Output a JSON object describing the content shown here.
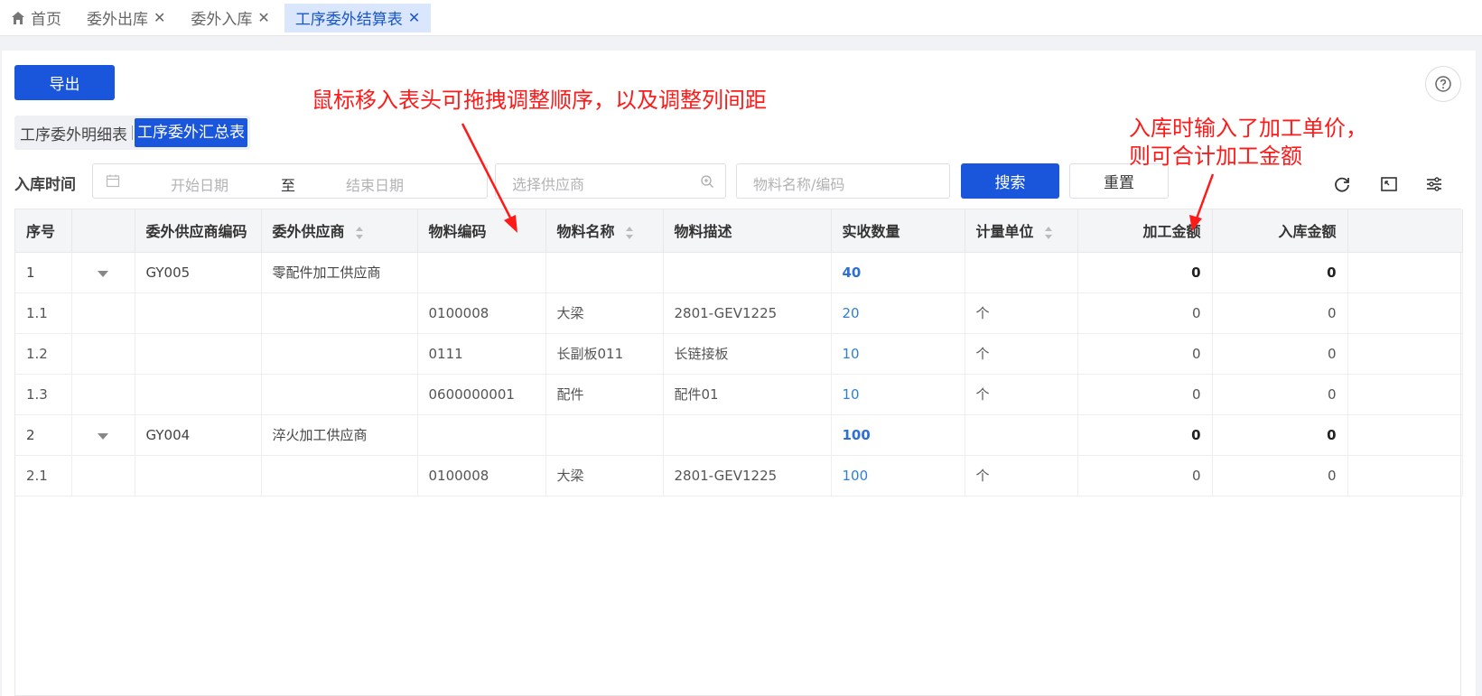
{
  "tabs": [
    {
      "label": "首页",
      "active": false,
      "closable": false,
      "icon": "home-icon"
    },
    {
      "label": "委外出库",
      "active": false,
      "closable": true
    },
    {
      "label": "委外入库",
      "active": false,
      "closable": true
    },
    {
      "label": "工序委外结算表",
      "active": true,
      "closable": true
    }
  ],
  "toolbar": {
    "export_label": "导出"
  },
  "segment": {
    "options": [
      "工序委外明细表",
      "工序委外汇总表"
    ],
    "active_index": 1
  },
  "filters": {
    "date_label": "入库时间",
    "start_placeholder": "开始日期",
    "separator": "至",
    "end_placeholder": "结束日期",
    "supplier_placeholder": "选择供应商",
    "material_placeholder": "物料名称/编码",
    "search_label": "搜索",
    "reset_label": "重置"
  },
  "table": {
    "headers": [
      "序号",
      "",
      "委外供应商编码",
      "委外供应商",
      "物料编码",
      "物料名称",
      "物料描述",
      "实收数量",
      "计量单位",
      "加工金额",
      "入库金额"
    ],
    "rows": [
      {
        "group": true,
        "cells": [
          "1",
          "",
          "GY005",
          "零配件加工供应商",
          "",
          "",
          "",
          "40",
          "",
          "0",
          "0"
        ]
      },
      {
        "group": false,
        "cells": [
          "1.1",
          "",
          "",
          "",
          "0100008",
          "大梁",
          "2801-GEV1225",
          "20",
          "个",
          "0",
          "0"
        ]
      },
      {
        "group": false,
        "cells": [
          "1.2",
          "",
          "",
          "",
          "0111",
          "长副板011",
          "长链接板",
          "10",
          "个",
          "0",
          "0"
        ]
      },
      {
        "group": false,
        "cells": [
          "1.3",
          "",
          "",
          "",
          "0600000001",
          "配件",
          "配件01",
          "10",
          "个",
          "0",
          "0"
        ]
      },
      {
        "group": true,
        "cells": [
          "2",
          "",
          "GY004",
          "淬火加工供应商",
          "",
          "",
          "",
          "100",
          "",
          "0",
          "0"
        ]
      },
      {
        "group": false,
        "cells": [
          "2.1",
          "",
          "",
          "",
          "0100008",
          "大梁",
          "2801-GEV1225",
          "100",
          "个",
          "0",
          "0"
        ]
      }
    ]
  },
  "annotations": {
    "header_note": "鼠标移入表头可拖拽调整顺序，以及调整列间距",
    "amount_note_line1": "入库时输入了加工单价，",
    "amount_note_line2": "则可合计加工金额"
  },
  "colors": {
    "primary": "#1a56db",
    "annotation": "#ff1a1a",
    "link_number": "#2f7fd8"
  }
}
